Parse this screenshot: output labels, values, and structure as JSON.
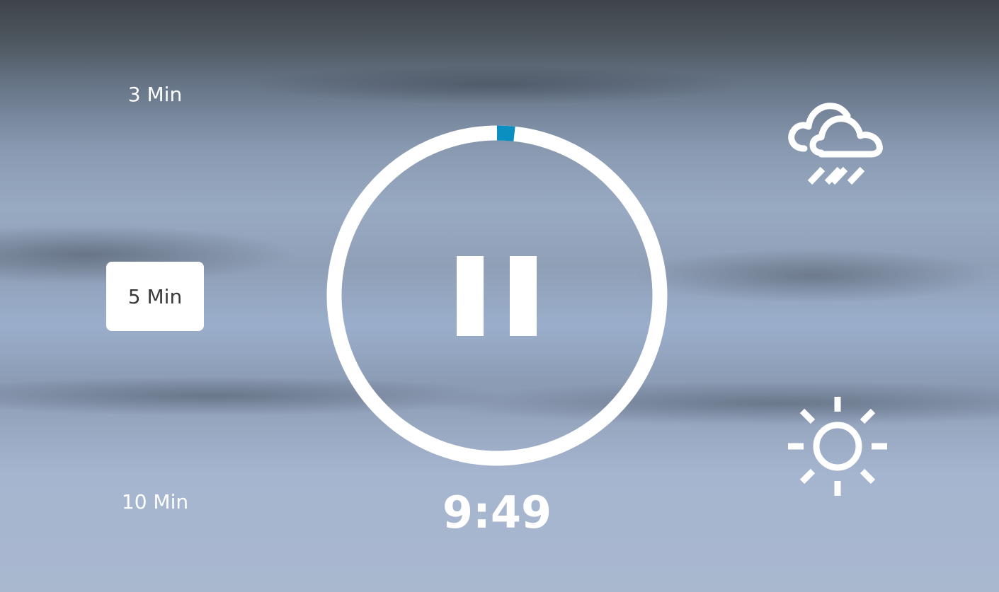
{
  "durations": {
    "three": "3 Min",
    "five": "5 Min",
    "ten": "10 Min",
    "selected": "5 Min"
  },
  "timer": {
    "remaining": "9:49",
    "progress": 0.017,
    "ring_color": "#ffffff",
    "progress_color": "#0a8fc0"
  },
  "sounds": {
    "rain_icon": "rain-cloud-icon",
    "sun_icon": "sun-icon"
  },
  "controls": {
    "pause_icon": "pause-icon"
  }
}
